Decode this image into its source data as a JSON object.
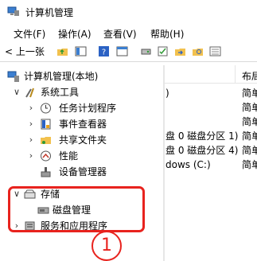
{
  "window": {
    "title": "计算机管理"
  },
  "menu": [
    "文件(F)",
    "操作(A)",
    "查看(V)",
    "帮助(H)"
  ],
  "toolbar": {
    "back_label": "< 上一张"
  },
  "tree": {
    "root": "计算机管理(本地)",
    "system_tools": "系统工具",
    "task_scheduler": "任务计划程序",
    "event_viewer": "事件查看器",
    "shared_folders": "共享文件夹",
    "performance": "性能",
    "device_manager": "设备管理器",
    "storage": "存储",
    "disk_management": "磁盘管理",
    "services_apps": "服务和应用程序"
  },
  "list": {
    "col_layout": "布局",
    "row_top": ")",
    "row_part1": "盘 0 磁盘分区 1)",
    "row_part4": "盘 0 磁盘分区 4)",
    "row_win": "dows (C:)",
    "simple": "简单"
  },
  "annotation": {
    "marker": "1"
  },
  "colors": {
    "accent": "#e8231e",
    "selection": "#cce8ff"
  }
}
